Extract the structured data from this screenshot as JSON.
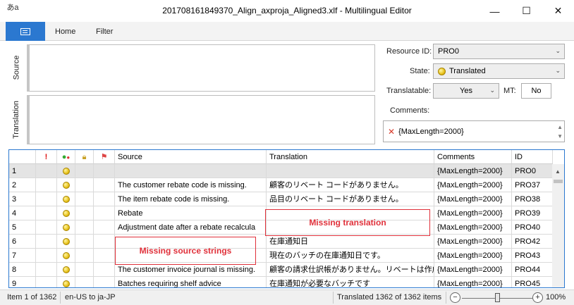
{
  "window": {
    "icon_glyph": "あa",
    "title": "201708161849370_Align_axproja_Aligned3.xlf - Multilingual Editor",
    "min_glyph": "—",
    "max_glyph": "☐",
    "close_glyph": "✕"
  },
  "ribbon": {
    "tabs": [
      {
        "label": "Home"
      },
      {
        "label": "Filter"
      }
    ]
  },
  "editor": {
    "source_label": "Source",
    "translation_label": "Translation",
    "source_text": "",
    "translation_text": ""
  },
  "properties": {
    "resource_id_label": "Resource ID:",
    "resource_id_value": "PRO0",
    "state_label": "State:",
    "state_value": "Translated",
    "translatable_label": "Translatable:",
    "translatable_value": "Yes",
    "mt_label": "MT:",
    "mt_value": "No",
    "comments_label": "Comments:",
    "comments_value": "{MaxLength=2000}"
  },
  "grid": {
    "headers": {
      "num": "",
      "flag": "!",
      "source": "Source",
      "translation": "Translation",
      "comments": "Comments",
      "id": "ID"
    },
    "rows": [
      {
        "num": "1",
        "source": "",
        "translation": "",
        "comments": "{MaxLength=2000}",
        "id": "PRO0"
      },
      {
        "num": "2",
        "source": "The customer rebate code is missing.",
        "translation": "顧客のリベート コードがありません。",
        "comments": "{MaxLength=2000}",
        "id": "PRO37"
      },
      {
        "num": "3",
        "source": "The item rebate code is missing.",
        "translation": "品目のリベート コードがありません。",
        "comments": "{MaxLength=2000}",
        "id": "PRO38"
      },
      {
        "num": "4",
        "source": "Rebate",
        "translation": "",
        "comments": "{MaxLength=2000}",
        "id": "PRO39"
      },
      {
        "num": "5",
        "source": "Adjustment date after a rebate recalcula",
        "translation": "",
        "comments": "{MaxLength=2000}",
        "id": "PRO40"
      },
      {
        "num": "6",
        "source": "",
        "translation": "在庫通知日",
        "comments": "{MaxLength=2000}",
        "id": "PRO42"
      },
      {
        "num": "7",
        "source": "",
        "translation": "現在のバッチの在庫通知日です。",
        "comments": "{MaxLength=2000}",
        "id": "PRO43"
      },
      {
        "num": "8",
        "source": "The customer invoice journal is missing.",
        "translation": "顧客の請求仕訳帳がありません。リベートは作成さ",
        "comments": "{MaxLength=2000}",
        "id": "PRO44"
      },
      {
        "num": "9",
        "source": "Batches requiring shelf advice",
        "translation": "在庫通知が必要なバッチです",
        "comments": "{MaxLength=2000}",
        "id": "PRO45"
      }
    ]
  },
  "annotations": {
    "missing_translation": "Missing translation",
    "missing_source": "Missing source strings"
  },
  "status": {
    "item_position": "Item 1 of 1362",
    "language_pair": "en-US to ja-JP",
    "translated_count": "Translated 1362 of 1362 items",
    "zoom_out": "−",
    "zoom_in": "+",
    "zoom_level": "100%"
  },
  "colors": {
    "accent": "#2b78d0",
    "annotation": "#e0303a",
    "translated_state": "#e8c21c"
  },
  "icons": {
    "window": "multilingual-app-icon",
    "file_tab": "file-menu-icon",
    "state": "translated-state-icon",
    "comment_error": "error-x-icon",
    "grid_columns": [
      "alert-icon",
      "state-icon",
      "lock-icon",
      "flag-icon"
    ]
  }
}
